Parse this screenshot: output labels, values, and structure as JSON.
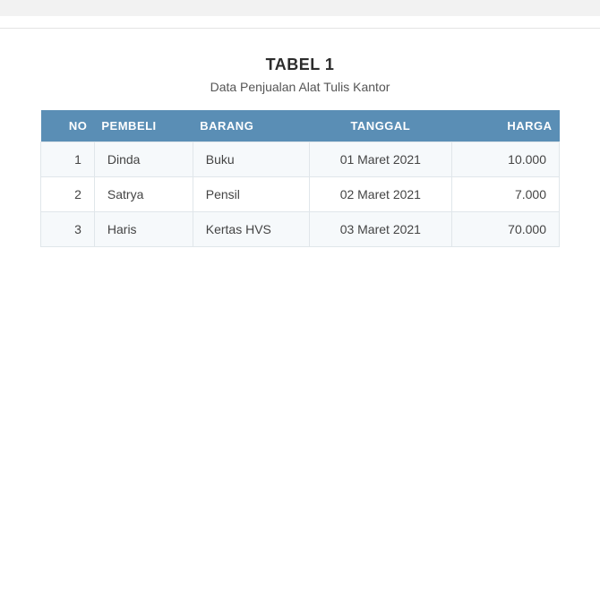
{
  "header": {
    "title": "TABEL 1",
    "subtitle": "Data Penjualan Alat Tulis Kantor"
  },
  "table": {
    "columns": {
      "no": "NO",
      "pembeli": "PEMBELI",
      "barang": "BARANG",
      "tanggal": "TANGGAL",
      "harga": "HARGA"
    },
    "rows": [
      {
        "no": "1",
        "pembeli": "Dinda",
        "barang": "Buku",
        "tanggal": "01 Maret 2021",
        "harga": "10.000"
      },
      {
        "no": "2",
        "pembeli": "Satrya",
        "barang": "Pensil",
        "tanggal": "02 Maret 2021",
        "harga": "7.000"
      },
      {
        "no": "3",
        "pembeli": "Haris",
        "barang": "Kertas HVS",
        "tanggal": "03 Maret 2021",
        "harga": "70.000"
      }
    ]
  }
}
